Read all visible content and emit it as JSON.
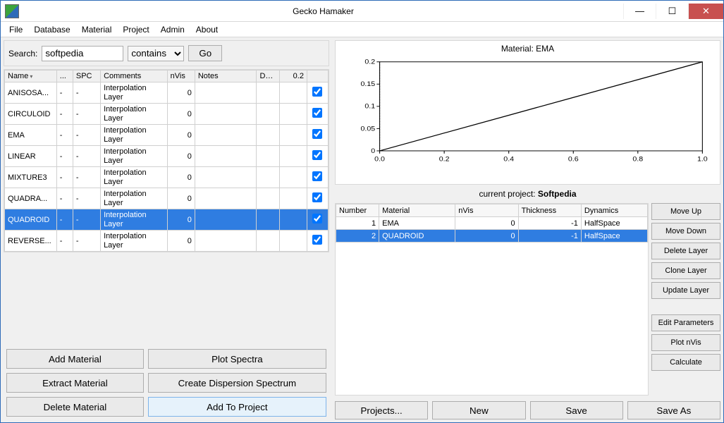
{
  "window": {
    "title": "Gecko Hamaker"
  },
  "menu": [
    "File",
    "Database",
    "Material",
    "Project",
    "Admin",
    "About"
  ],
  "search": {
    "label": "Search:",
    "value": "softpedia",
    "mode": "contains",
    "go": "Go"
  },
  "material_table": {
    "headers": [
      "Name",
      "...",
      "SPC",
      "Comments",
      "nVis",
      "Notes",
      "DS...",
      "0.2",
      ""
    ],
    "rows": [
      {
        "name": "ANISOSA...",
        "dots": "-",
        "spc": "-",
        "comments": "Interpolation Layer",
        "nvis": "0",
        "notes": "",
        "ds": "",
        "num": "",
        "chk": true,
        "sel": false
      },
      {
        "name": "CIRCULOID",
        "dots": "-",
        "spc": "-",
        "comments": "Interpolation Layer",
        "nvis": "0",
        "notes": "",
        "ds": "",
        "num": "",
        "chk": true,
        "sel": false
      },
      {
        "name": "EMA",
        "dots": "-",
        "spc": "-",
        "comments": "Interpolation Layer",
        "nvis": "0",
        "notes": "",
        "ds": "",
        "num": "",
        "chk": true,
        "sel": false
      },
      {
        "name": "LINEAR",
        "dots": "-",
        "spc": "-",
        "comments": "Interpolation Layer",
        "nvis": "0",
        "notes": "",
        "ds": "",
        "num": "",
        "chk": true,
        "sel": false
      },
      {
        "name": "MIXTURE3",
        "dots": "-",
        "spc": "-",
        "comments": "Interpolation Layer",
        "nvis": "0",
        "notes": "",
        "ds": "",
        "num": "",
        "chk": true,
        "sel": false
      },
      {
        "name": "QUADRA...",
        "dots": "-",
        "spc": "-",
        "comments": "Interpolation Layer",
        "nvis": "0",
        "notes": "",
        "ds": "",
        "num": "",
        "chk": true,
        "sel": false
      },
      {
        "name": "QUADROID",
        "dots": "-",
        "spc": "-",
        "comments": "Interpolation Layer",
        "nvis": "0",
        "notes": "",
        "ds": "",
        "num": "",
        "chk": true,
        "sel": true
      },
      {
        "name": "REVERSE...",
        "dots": "-",
        "spc": "-",
        "comments": "Interpolation Layer",
        "nvis": "0",
        "notes": "",
        "ds": "",
        "num": "",
        "chk": true,
        "sel": false
      }
    ]
  },
  "left_buttons": {
    "add_material": "Add Material",
    "plot_spectra": "Plot Spectra",
    "extract_material": "Extract Material",
    "create_dispersion": "Create Dispersion Spectrum",
    "delete_material": "Delete Material",
    "add_to_project": "Add To Project"
  },
  "chart": {
    "title": "Material: EMA"
  },
  "chart_data": {
    "type": "line",
    "x": [
      0.0,
      0.2,
      0.4,
      0.6,
      0.8,
      1.0
    ],
    "y": [
      0.0,
      0.04,
      0.08,
      0.12,
      0.16,
      0.2
    ],
    "xlim": [
      0.0,
      1.0
    ],
    "ylim": [
      0.0,
      0.2
    ],
    "xticks": [
      0.0,
      0.2,
      0.4,
      0.6,
      0.8,
      1.0
    ],
    "yticks": [
      0.0,
      0.05,
      0.1,
      0.15,
      0.2
    ],
    "title": "Material: EMA"
  },
  "project": {
    "label": "current project:",
    "name": "Softpedia"
  },
  "layer_table": {
    "headers": [
      "Number",
      "Material",
      "nVis",
      "Thickness",
      "Dynamics"
    ],
    "rows": [
      {
        "num": "1",
        "mat": "EMA",
        "nvis": "0",
        "thk": "-1",
        "dyn": "HalfSpace",
        "sel": false
      },
      {
        "num": "2",
        "mat": "QUADROID",
        "nvis": "0",
        "thk": "-1",
        "dyn": "HalfSpace",
        "sel": true
      }
    ]
  },
  "layer_buttons": {
    "move_up": "Move Up",
    "move_down": "Move Down",
    "delete_layer": "Delete Layer",
    "clone_layer": "Clone Layer",
    "update_layer": "Update Layer",
    "edit_params": "Edit Parameters",
    "plot_nvis": "Plot nVis",
    "calculate": "Calculate"
  },
  "project_buttons": {
    "projects": "Projects...",
    "new": "New",
    "save": "Save",
    "save_as": "Save As"
  }
}
